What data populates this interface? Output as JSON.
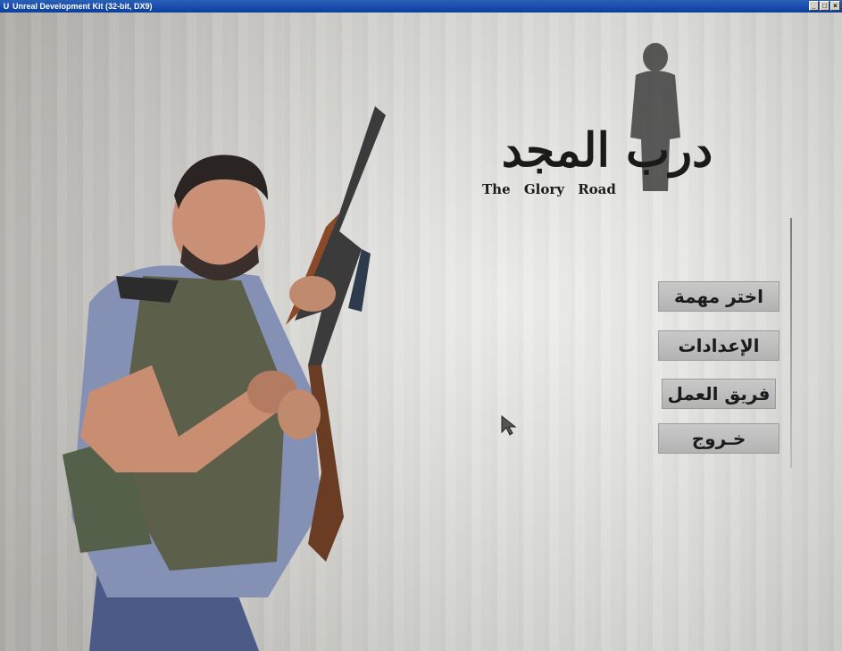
{
  "window": {
    "title": "Unreal Development Kit (32-bit, DX9)",
    "app_icon": "U",
    "buttons": [
      "_",
      "□",
      "×"
    ]
  },
  "game": {
    "logo_arabic": "درب المجد",
    "logo_english": "The Glory Road"
  },
  "menu": {
    "items": [
      {
        "label": "اختر مهمة"
      },
      {
        "label": "الإعدادات"
      },
      {
        "label": "فريق العمل"
      },
      {
        "label": "خـروج"
      }
    ]
  },
  "colors": {
    "titlebar": "#0a3f9e",
    "button_bg": "#bdbdbd",
    "logo_red": "#b3141a"
  }
}
